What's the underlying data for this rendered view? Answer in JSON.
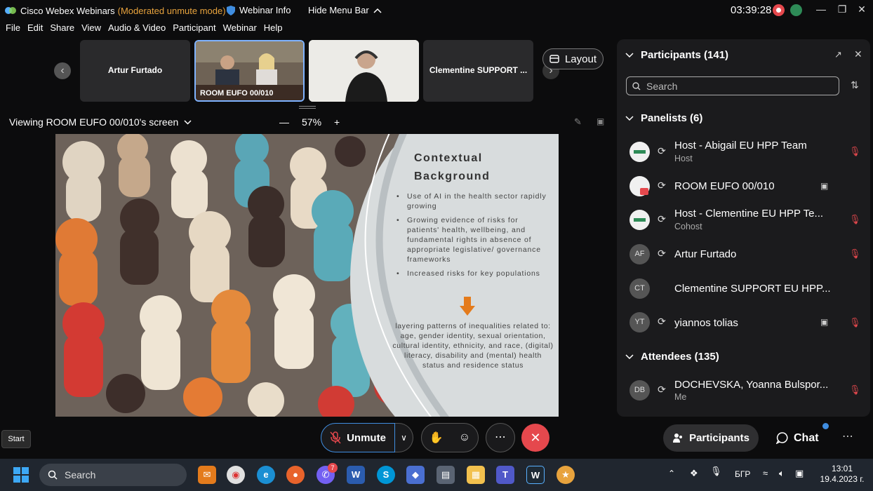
{
  "titlebar": {
    "app_title": "Cisco Webex Webinars",
    "mode": "(Moderated unmute mode)",
    "webinar_info": "Webinar Info",
    "hide_menu": "Hide Menu Bar",
    "timer": "03:39:28",
    "minimize_icon": "minimize-icon",
    "maximize_icon": "maximize-icon",
    "close_icon": "close-icon"
  },
  "menubar": {
    "items": [
      "File",
      "Edit",
      "Share",
      "View",
      "Audio & Video",
      "Participant",
      "Webinar",
      "Help"
    ]
  },
  "stage": {
    "thumbnails": [
      {
        "name": "Artur Furtado"
      },
      {
        "name": "ROOM EUFO 00/010"
      },
      {
        "name": ""
      },
      {
        "name": "Clementine SUPPORT  ..."
      }
    ],
    "layout_label": "Layout",
    "viewing_label": "Viewing ROOM EUFO 00/010's screen",
    "zoom_label": "57%"
  },
  "slide": {
    "title_line1": "Contextual",
    "title_line2": "Background",
    "bullets": [
      "Use of AI in the health sector rapidly growing",
      "Growing evidence of risks for patients' health, wellbeing, and fundamental rights in absence of appropriate legislative/ governance frameworks",
      "Increased risks for key populations"
    ],
    "footer": "layering patterns of inequalities related to: age, gender identity, sexual orientation, cultural identity, ethnicity, and race, (digital) literacy, disability and (mental) health status and residence status"
  },
  "controls": {
    "unmute_label": "Unmute",
    "start_tooltip": "Start"
  },
  "panel": {
    "title": "Participants (141)",
    "search_placeholder": "Search",
    "panelists_header": "Panelists (6)",
    "panelists": [
      {
        "initials": "",
        "name": "Host - Abigail EU HPP Team",
        "role": "Host"
      },
      {
        "initials": "",
        "name": "ROOM EUFO 00/010",
        "role": ""
      },
      {
        "initials": "",
        "name": "Host - Clementine EU HPP Te...",
        "role": "Cohost"
      },
      {
        "initials": "AF",
        "name": "Artur Furtado",
        "role": ""
      },
      {
        "initials": "CT",
        "name": "Clementine SUPPORT  EU HPP...",
        "role": ""
      },
      {
        "initials": "YT",
        "name": "yiannos tolias",
        "role": ""
      }
    ],
    "attendees_header": "Attendees (135)",
    "attendees": [
      {
        "initials": "DB",
        "name": "DOCHEVSKA, Yoanna Bulspor...",
        "role": "Me"
      }
    ],
    "tab_participants": "Participants",
    "tab_chat": "Chat"
  },
  "taskbar": {
    "search_label": "Search",
    "lang": "БГР",
    "time": "13:01",
    "date": "19.4.2023 г.",
    "badge_count": "7"
  },
  "colors": {
    "accent": "#3f8de0",
    "danger": "#e5484d",
    "mode_text": "#e8a33d"
  }
}
